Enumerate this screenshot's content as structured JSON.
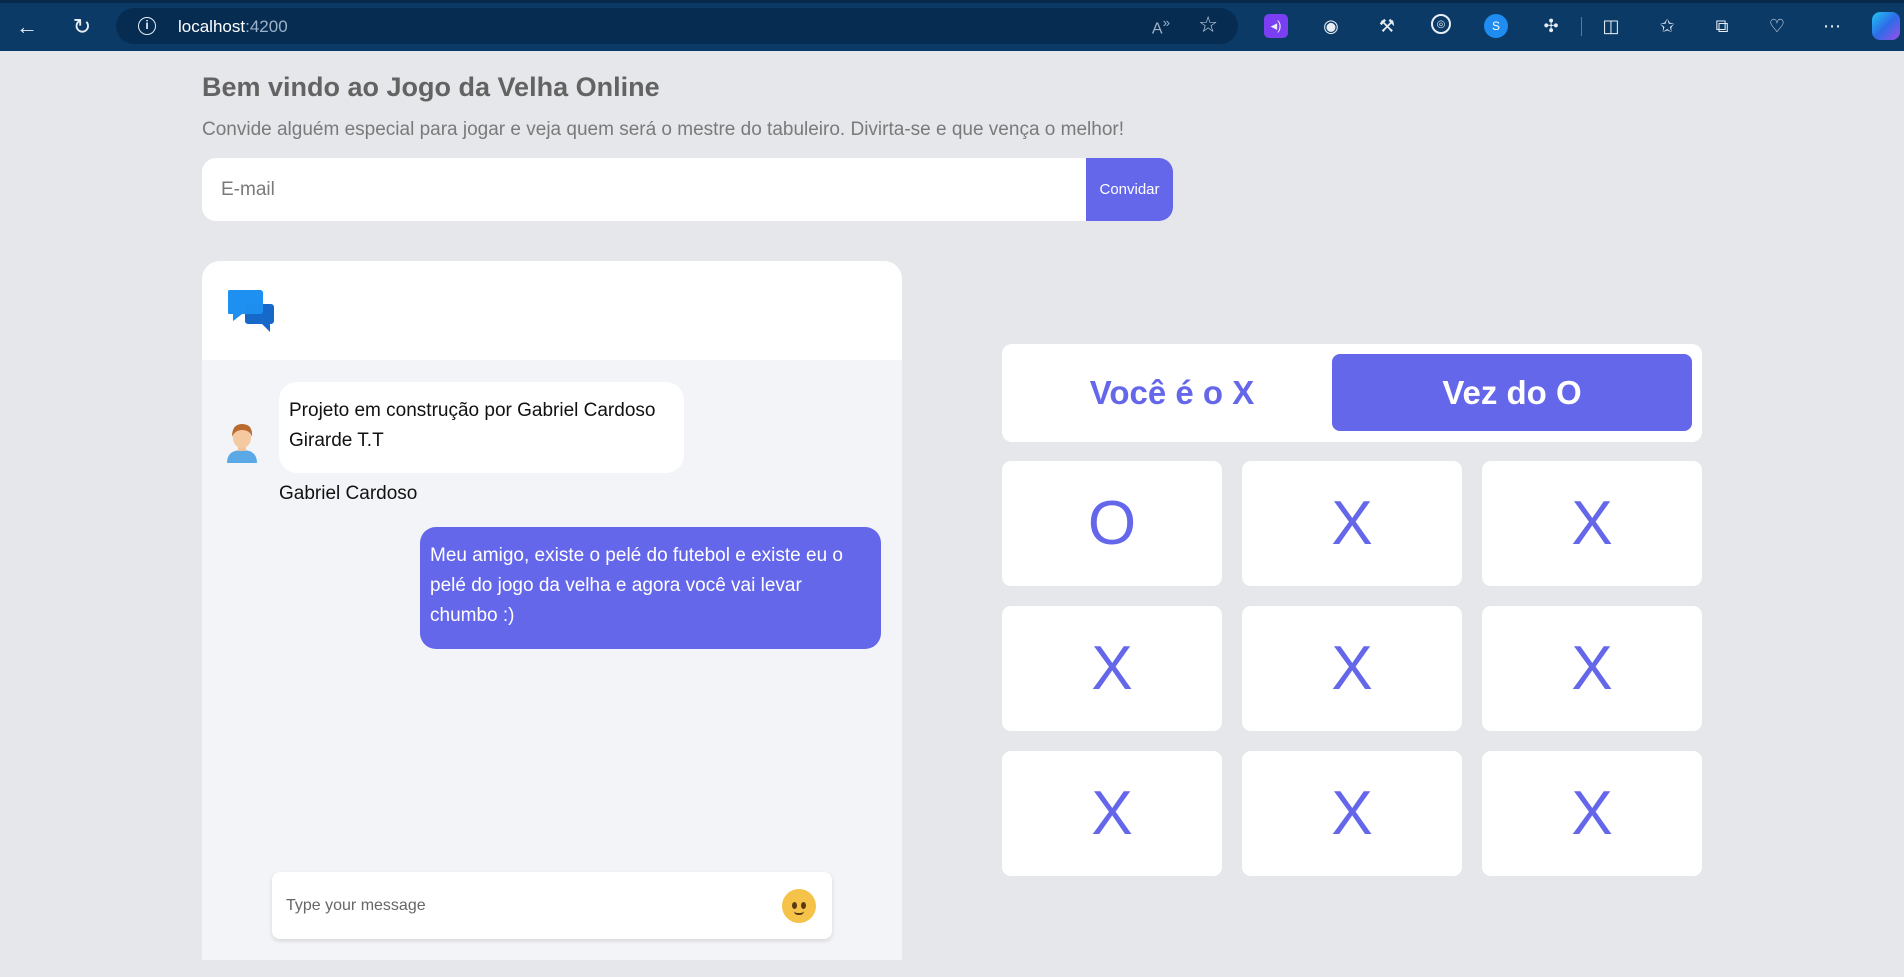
{
  "browser": {
    "url_host": "localhost",
    "url_port": ":4200"
  },
  "header": {
    "title": "Bem vindo ao Jogo da Velha Online",
    "subtitle": "Convide alguém especial para jogar e veja quem será o mestre do tabuleiro. Divirta-se e que vença o melhor!",
    "email_placeholder": "E-mail",
    "invite_label": "Convidar"
  },
  "chat": {
    "messages": [
      {
        "text": "Projeto em construção por Gabriel Cardoso Girarde T.T",
        "sender": "Gabriel Cardoso"
      },
      {
        "text": "Meu amigo, existe o pelé do futebol e existe eu o pelé do jogo da velha e agora você vai levar chumbo :)"
      }
    ],
    "composer_placeholder": "Type your message"
  },
  "game": {
    "player_label": "Você é o X",
    "turn_label": "Vez do O",
    "board": [
      "O",
      "X",
      "X",
      "X",
      "X",
      "X",
      "X",
      "X",
      "X"
    ]
  },
  "colors": {
    "accent": "#6567eb",
    "page_bg": "#e6e7eb",
    "browser_bar": "#0b3a66"
  }
}
